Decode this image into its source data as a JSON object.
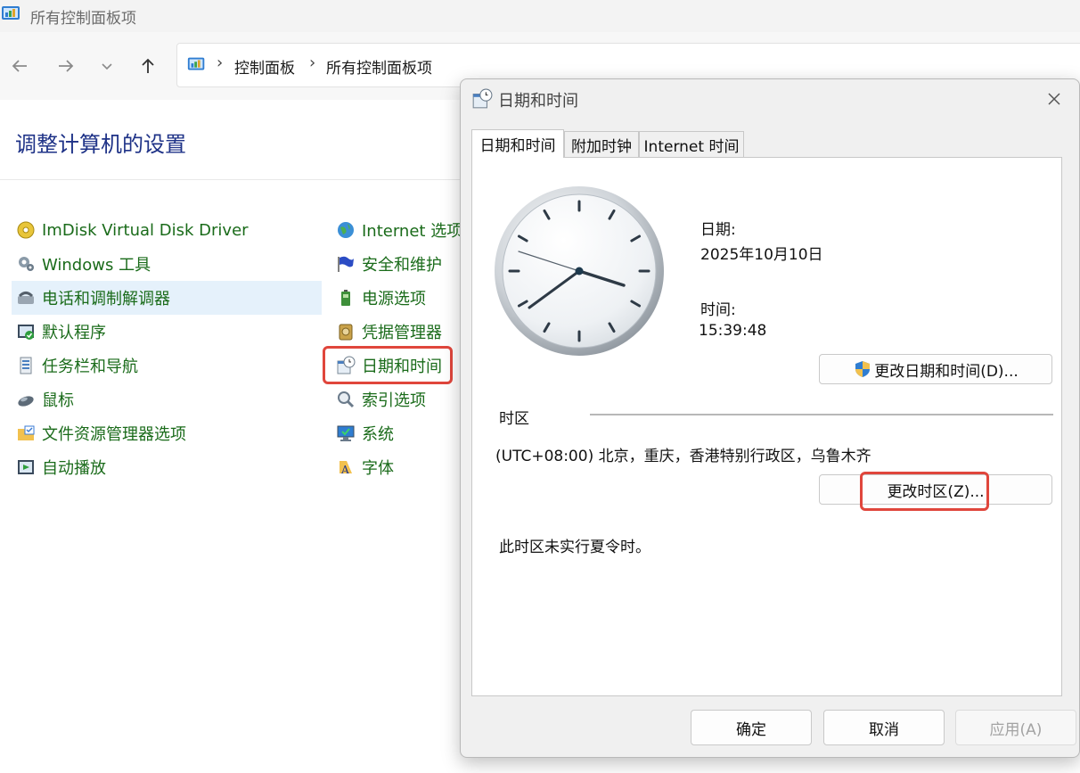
{
  "window": {
    "title": "所有控制面板项"
  },
  "address": {
    "crumbs": [
      "控制面板",
      "所有控制面板项"
    ]
  },
  "page": {
    "heading": "调整计算机的设置"
  },
  "colors": {
    "link_green": "#1a6b1a",
    "heading_blue": "#1e3287",
    "highlight_red": "#e0463c",
    "selected_bg": "#e5f1fb"
  },
  "items_left": [
    {
      "label": "ImDisk Virtual Disk Driver",
      "icon": "disk-icon"
    },
    {
      "label": "Windows 工具",
      "icon": "tools-icon"
    },
    {
      "label": "电话和调制解调器",
      "icon": "phone-icon"
    },
    {
      "label": "默认程序",
      "icon": "default-programs-icon"
    },
    {
      "label": "任务栏和导航",
      "icon": "taskbar-icon"
    },
    {
      "label": "鼠标",
      "icon": "mouse-icon"
    },
    {
      "label": "文件资源管理器选项",
      "icon": "folder-options-icon"
    },
    {
      "label": "自动播放",
      "icon": "autoplay-icon"
    }
  ],
  "items_right": [
    {
      "label": "Internet 选项",
      "icon": "internet-globe-icon"
    },
    {
      "label": "安全和维护",
      "icon": "flag-icon"
    },
    {
      "label": "电源选项",
      "icon": "battery-icon"
    },
    {
      "label": "凭据管理器",
      "icon": "credential-vault-icon"
    },
    {
      "label": "日期和时间",
      "icon": "date-time-icon"
    },
    {
      "label": "索引选项",
      "icon": "index-search-icon"
    },
    {
      "label": "系统",
      "icon": "monitor-icon"
    },
    {
      "label": "字体",
      "icon": "fonts-icon"
    }
  ],
  "dialog": {
    "title": "日期和时间",
    "tabs": [
      "日期和时间",
      "附加时钟",
      "Internet 时间"
    ],
    "date_label": "日期:",
    "date_value": "2025年10月10日",
    "time_label": "时间:",
    "time_value": "15:39:48",
    "change_datetime_button": "更改日期和时间(D)...",
    "timezone_section": "时区",
    "timezone_value": "(UTC+08:00) 北京，重庆，香港特别行政区，乌鲁木齐",
    "change_timezone_button": "更改时区(Z)...",
    "dst_note": "此时区未实行夏令时。",
    "ok_button": "确定",
    "cancel_button": "取消",
    "apply_button": "应用(A)"
  }
}
